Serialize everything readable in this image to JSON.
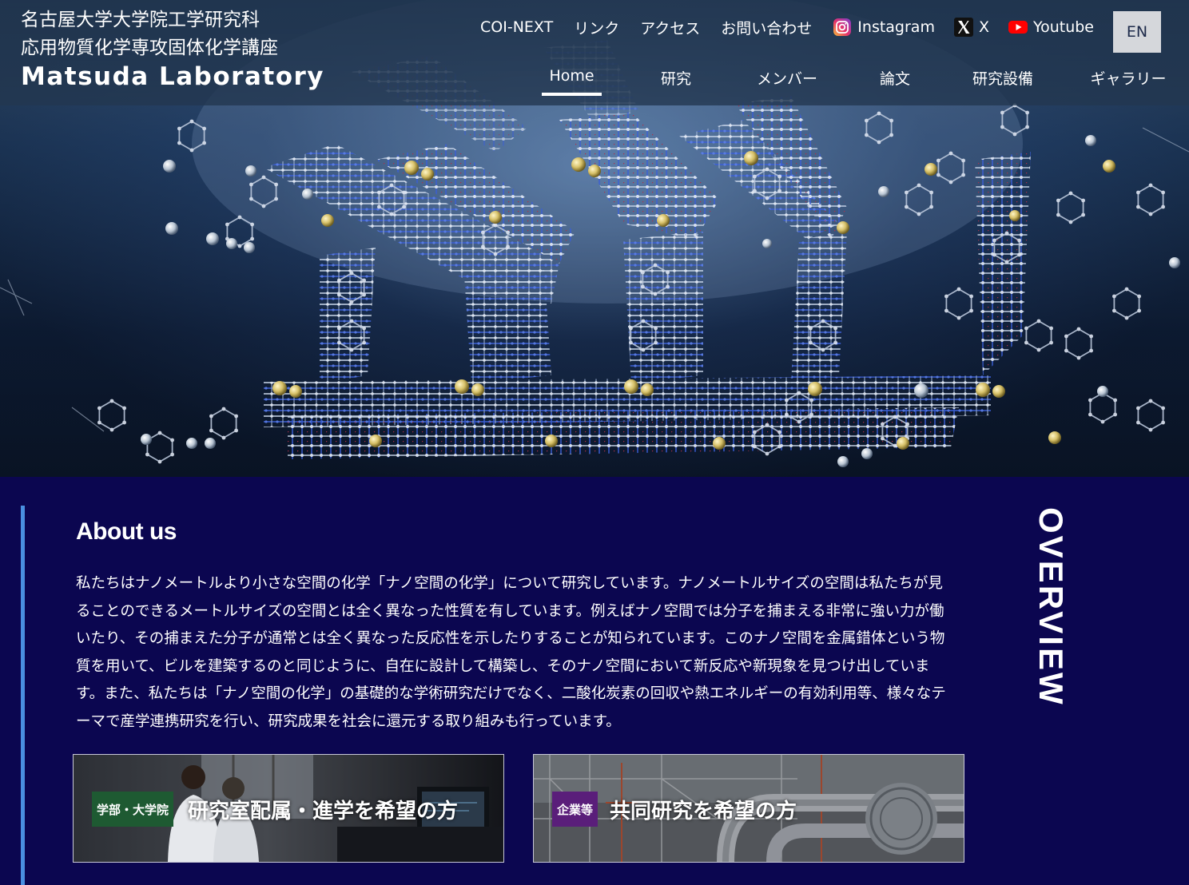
{
  "header": {
    "university": "名古屋大学大学院工学研究科",
    "department": "応用物質化学専攻固体化学講座",
    "lab_name": "Matsuda Laboratory"
  },
  "top_nav": {
    "links": [
      "COI-NEXT",
      "リンク",
      "アクセス",
      "お問い合わせ"
    ],
    "social": [
      {
        "label": "Instagram",
        "icon": "instagram-icon"
      },
      {
        "label": "X",
        "icon": "x-icon"
      },
      {
        "label": "Youtube",
        "icon": "youtube-icon"
      }
    ],
    "lang_button": "EN"
  },
  "main_nav": {
    "items": [
      "Home",
      "研究",
      "メンバー",
      "論文",
      "研究設備",
      "ギャラリー"
    ],
    "active": "Home"
  },
  "hero": {
    "image": "molecular-framework-illustration"
  },
  "about": {
    "heading": "About us",
    "side_label": "OVERVIEW",
    "body": "私たちはナノメートルより小さな空間の化学「ナノ空間の化学」について研究しています。ナノメートルサイズの空間は私たちが見ることのできるメートルサイズの空間とは全く異なった性質を有しています。例えばナノ空間では分子を捕まえる非常に強い力が働いたり、その捕まえた分子が通常とは全く異なった反応性を示したりすることが知られています。このナノ空間を金属錯体という物質を用いて、ビルを建築するのと同じように、自在に設計して構築し、そのナノ空間において新反応や新現象を見つけ出しています。また、私たちは「ナノ空間の化学」の基礎的な学術研究だけでなく、二酸化炭素の回収や熱エネルギーの有効利用等、様々なテーマで産学連携研究を行い、研究成果を社会に還元する取り組みも行っています。"
  },
  "cards": [
    {
      "tag": "学部・大学院",
      "title": "研究室配属・進学を希望の方",
      "tag_color": "#1e5a32"
    },
    {
      "tag": "企業等",
      "title": "共同研究を希望の方",
      "tag_color": "#5a1e7a"
    }
  ],
  "colors": {
    "page_bg": "#0b0650",
    "accent_bar": "#4a8fe0",
    "lang_button_bg": "#d5d7db"
  }
}
